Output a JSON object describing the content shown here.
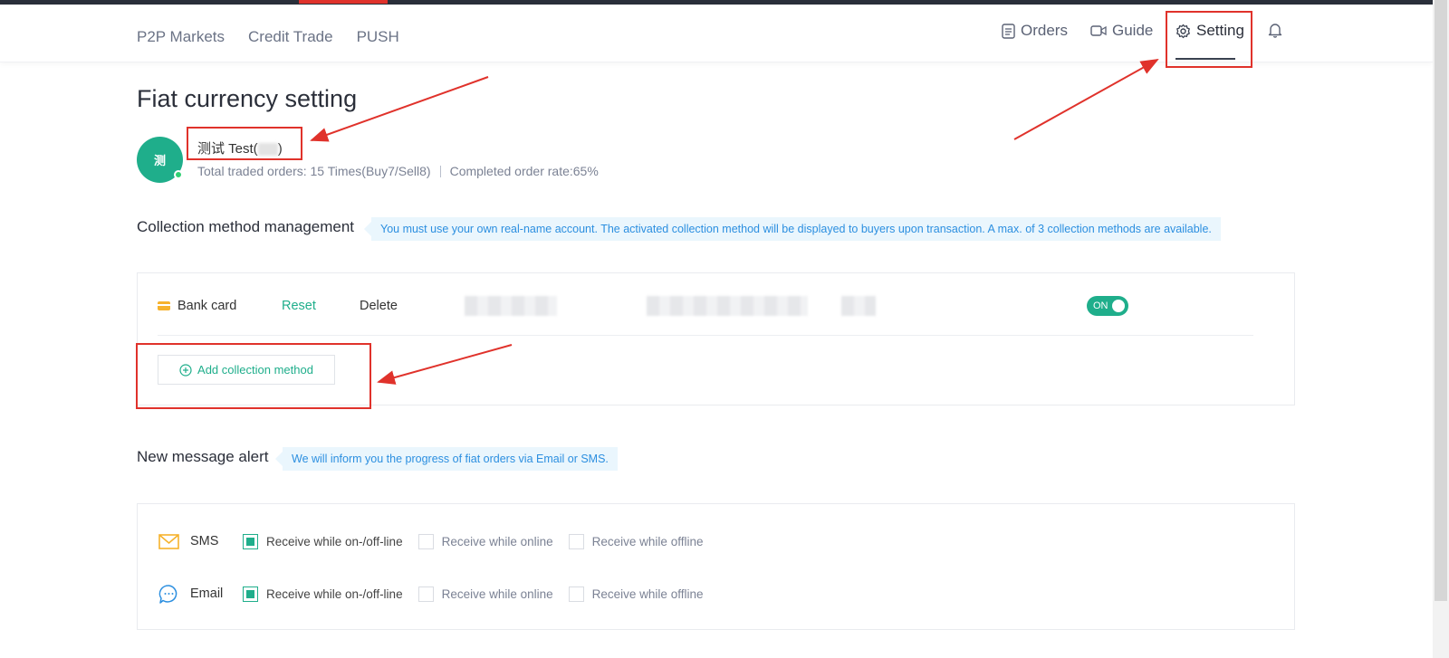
{
  "nav": {
    "left": [
      "P2P Markets",
      "Credit Trade",
      "PUSH"
    ],
    "orders": "Orders",
    "guide": "Guide",
    "setting": "Setting"
  },
  "page": {
    "title": "Fiat currency setting"
  },
  "user": {
    "avatar_char": "测",
    "name": "测试 Test(",
    "name_suffix": ")",
    "total_orders": "Total traded orders: 15 Times(Buy7/Sell8)",
    "completion_rate": "Completed order rate:65%"
  },
  "collection": {
    "title": "Collection method management",
    "tip": "You must use your own real-name account. The activated collection method will be displayed to buyers upon transaction. A max. of 3 collection methods are available.",
    "method_name": "Bank card",
    "reset": "Reset",
    "delete": "Delete",
    "toggle": "ON",
    "add_button": "Add collection method"
  },
  "alerts": {
    "title": "New message alert",
    "tip": "We will inform you the progress of fiat orders via Email or SMS.",
    "rows": [
      {
        "label": "SMS",
        "options": [
          {
            "label": "Receive while on-/off-line",
            "checked": true
          },
          {
            "label": "Receive while online",
            "checked": false
          },
          {
            "label": "Receive while offline",
            "checked": false
          }
        ]
      },
      {
        "label": "Email",
        "options": [
          {
            "label": "Receive while on-/off-line",
            "checked": true
          },
          {
            "label": "Receive while online",
            "checked": false
          },
          {
            "label": "Receive while offline",
            "checked": false
          }
        ]
      }
    ]
  },
  "colors": {
    "accent": "#1fae8b",
    "annotation": "#e0322b",
    "tip_text": "#2c8fe0"
  }
}
